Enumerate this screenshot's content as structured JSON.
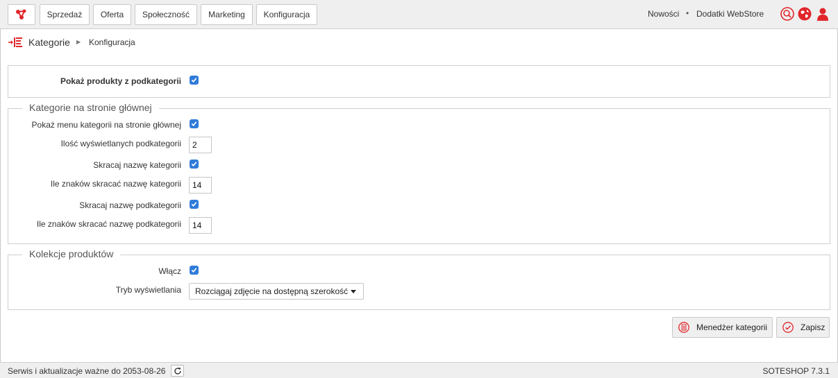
{
  "nav": {
    "items": [
      {
        "label": "Sprzedaż"
      },
      {
        "label": "Oferta"
      },
      {
        "label": "Społeczność"
      },
      {
        "label": "Marketing"
      },
      {
        "label": "Konfiguracja"
      }
    ],
    "news": "Nowości",
    "separator": "•",
    "webstore": "Dodatki WebStore",
    "icons": [
      "search-icon",
      "globe-icon",
      "user-icon"
    ],
    "brand_color": "#e0262b"
  },
  "breadcrumb": {
    "icon": "category-tree-icon",
    "title": "Kategorie",
    "separator": "▶",
    "current": "Konfiguracja"
  },
  "panel_general": {
    "show_subcategory_products": {
      "label": "Pokaż produkty z podkategorii",
      "checked": true
    }
  },
  "panel_home": {
    "legend": "Kategorie na stronie głównej",
    "show_menu": {
      "label": "Pokaż menu kategorii na stronie głównej",
      "checked": true
    },
    "subcategory_count": {
      "label": "Ilość wyświetlanych podkategorii",
      "value": "2"
    },
    "shorten_category": {
      "label": "Skracaj nazwę kategorii",
      "checked": true
    },
    "category_chars": {
      "label": "Ile znaków skracać nazwę kategorii",
      "value": "14"
    },
    "shorten_subcategory": {
      "label": "Skracaj nazwę podkategorii",
      "checked": true
    },
    "subcategory_chars": {
      "label": "Ile znaków skracać nazwę podkategorii",
      "value": "14"
    }
  },
  "panel_collections": {
    "legend": "Kolekcje produktów",
    "enable": {
      "label": "Włącz",
      "checked": true
    },
    "display_mode": {
      "label": "Tryb wyświetlania",
      "value": "Rozciągaj zdjęcie na dostępną szerokość"
    }
  },
  "actions": {
    "manager": "Menedżer kategorii",
    "save": "Zapisz"
  },
  "footer": {
    "status": "Serwis i aktualizacje ważne do 2053-08-26",
    "version": "SOTESHOP 7.3.1"
  },
  "colors": {
    "accent": "#e0262b",
    "checkbox": "#2f7bd9"
  }
}
